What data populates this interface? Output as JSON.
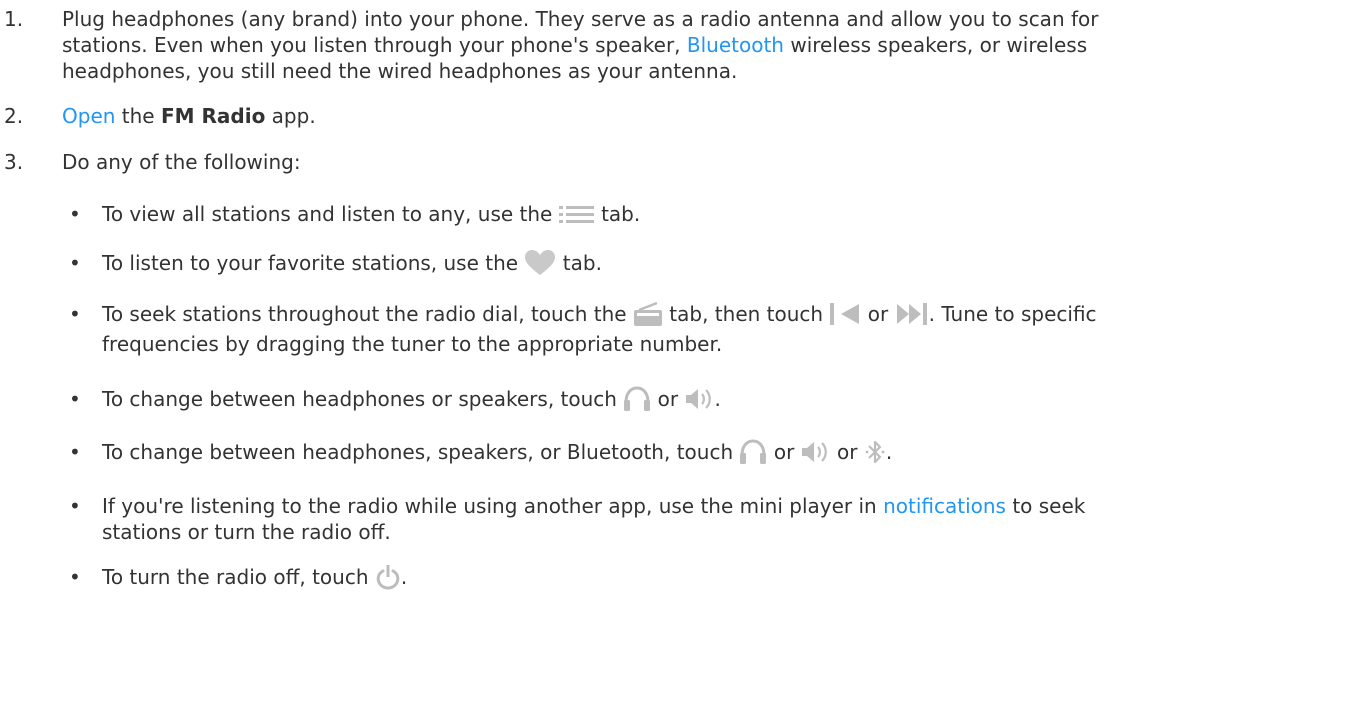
{
  "steps": [
    {
      "number": "1.",
      "lines": [
        {
          "before": "Plug headphones (any brand) into your phone. They serve as a radio antenna and allow you to scan for"
        },
        {
          "before": "stations. Even when you listen through your phone's speaker, ",
          "link": "Bluetooth",
          "after": " wireless speakers, or wireless"
        },
        {
          "before": "headphones, you still need the wired headphones as your antenna."
        }
      ]
    },
    {
      "number": "2.",
      "link": "Open",
      "middle": " the ",
      "bold": "FM Radio",
      "after": " app."
    },
    {
      "number": "3.",
      "text": "Do any of the following:"
    }
  ],
  "bullets": [
    {
      "symbol": "•",
      "before": "To view all stations and listen to any, use the ",
      "icon": "list-icon",
      "after": " tab."
    },
    {
      "symbol": "•",
      "before": "To listen to your favorite stations, use the ",
      "icon": "heart-icon",
      "after": " tab."
    },
    {
      "symbol": "•",
      "line1_a": "To seek stations throughout the radio dial, touch the ",
      "icon1": "radio-icon",
      "line1_b": " tab, then touch ",
      "icon2": "seek-back-icon",
      "line1_c": " or ",
      "icon3": "seek-forward-icon",
      "line1_d": ". Tune to specific",
      "line2": "frequencies by dragging the tuner to the appropriate number."
    },
    {
      "symbol": "•",
      "before": "To change between headphones or speakers, touch ",
      "icon1": "headphones-icon",
      "mid": " or ",
      "icon2": "speaker-icon",
      "after": "."
    },
    {
      "symbol": "•",
      "before": "To change between headphones, speakers, or Bluetooth, touch ",
      "icon1": "headphones-icon",
      "mid1": " or ",
      "icon2": "speaker-icon",
      "mid2": " or ",
      "icon3": "bluetooth-icon",
      "after": "."
    },
    {
      "symbol": "•",
      "before": "If you're listening to the radio while using another app, use the mini player in ",
      "link": "notifications",
      "after": " to seek",
      "line2": "stations or turn the radio off."
    },
    {
      "symbol": "•",
      "before": "To turn the radio off, touch ",
      "icon": "power-icon",
      "after": "."
    }
  ],
  "colors": {
    "text": "#333333",
    "link": "#2196f3",
    "icon": "#bdbdbd"
  }
}
